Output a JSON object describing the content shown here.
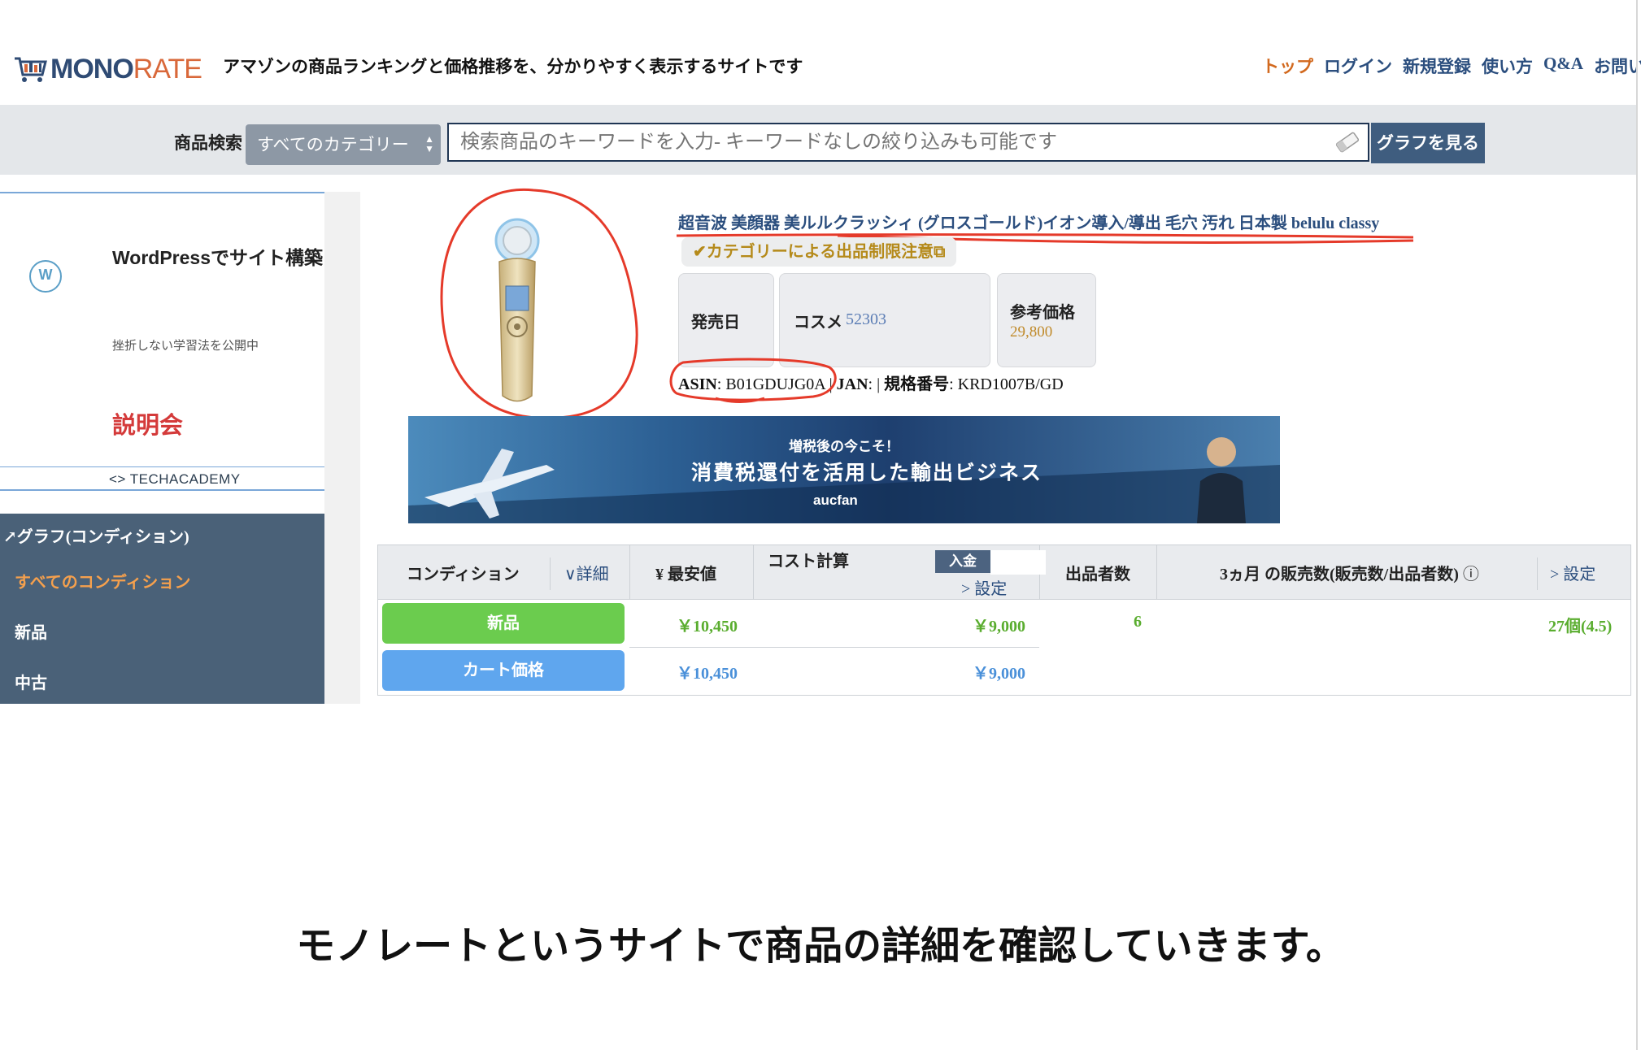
{
  "header": {
    "logo_part1": "MONO",
    "logo_part2": "RATE",
    "tagline": "アマゾンの商品ランキングと価格推移を、分かりやすく表示するサイトです",
    "nav": [
      "トップ",
      "ログイン",
      "新規登録",
      "使い方",
      "Q&A",
      "お問い合"
    ]
  },
  "search": {
    "label": "商品検索",
    "category": "すべてのカテゴリー",
    "placeholder": "検索商品のキーワードを入力- キーワードなしの絞り込みも可能です",
    "button": "グラフを見る"
  },
  "ad": {
    "title": "WordPressでサイト構築",
    "subtitle": "挫折しない学習法を公開中",
    "cta": "説明会",
    "footer": "<> TECHACADEMY"
  },
  "condition_panel": {
    "title": "グラフ(コンディション)",
    "items": [
      "すべてのコンディション",
      "新品",
      "中古"
    ]
  },
  "product": {
    "title": "超音波 美顔器 美ルルクラッシィ (グロスゴールド)イオン導入/導出 毛穴 汚れ 日本製 belulu classy",
    "restriction": "✔カテゴリーによる出品制限注意",
    "release_label": "発売日",
    "category_label": "コスメ",
    "category_rank": "52303",
    "ref_price_label": "参考価格",
    "ref_price": "29,800",
    "asin_label": "ASIN",
    "asin": "B01GDUJG0A",
    "jan_label": "JAN",
    "model_label": "規格番号",
    "model": "KRD1007B/GD"
  },
  "banner": {
    "line1": "増税後の今こそ！",
    "line2": "消費税還付を活用した輸出ビジネス",
    "brand": "aucfan"
  },
  "table": {
    "headers": {
      "condition": "コンディション",
      "detail": "∨詳細",
      "lowest": "¥ 最安値",
      "cost": "コスト計算",
      "deposit": "入金",
      "cost_setting": "> 設定",
      "sellers": "出品者数",
      "sales": "3ヵ月 の販売数(販売数/出品者数)",
      "sales_setting": "> 設定"
    },
    "rows": [
      {
        "condition": "新品",
        "lowest": "￥10,450",
        "cost": "￥9,000",
        "sellers": "6",
        "sales": "27個(4.5)"
      },
      {
        "condition": "カート価格",
        "lowest": "￥10,450",
        "cost": "￥9,000"
      }
    ],
    "colors": {
      "new": "#6bcc4e",
      "cart": "#5fa6ee",
      "value_green": "#5aad2f",
      "value_blue": "#4a90d9"
    }
  },
  "caption": "モノレートというサイトで商品の詳細を確認していきます。"
}
